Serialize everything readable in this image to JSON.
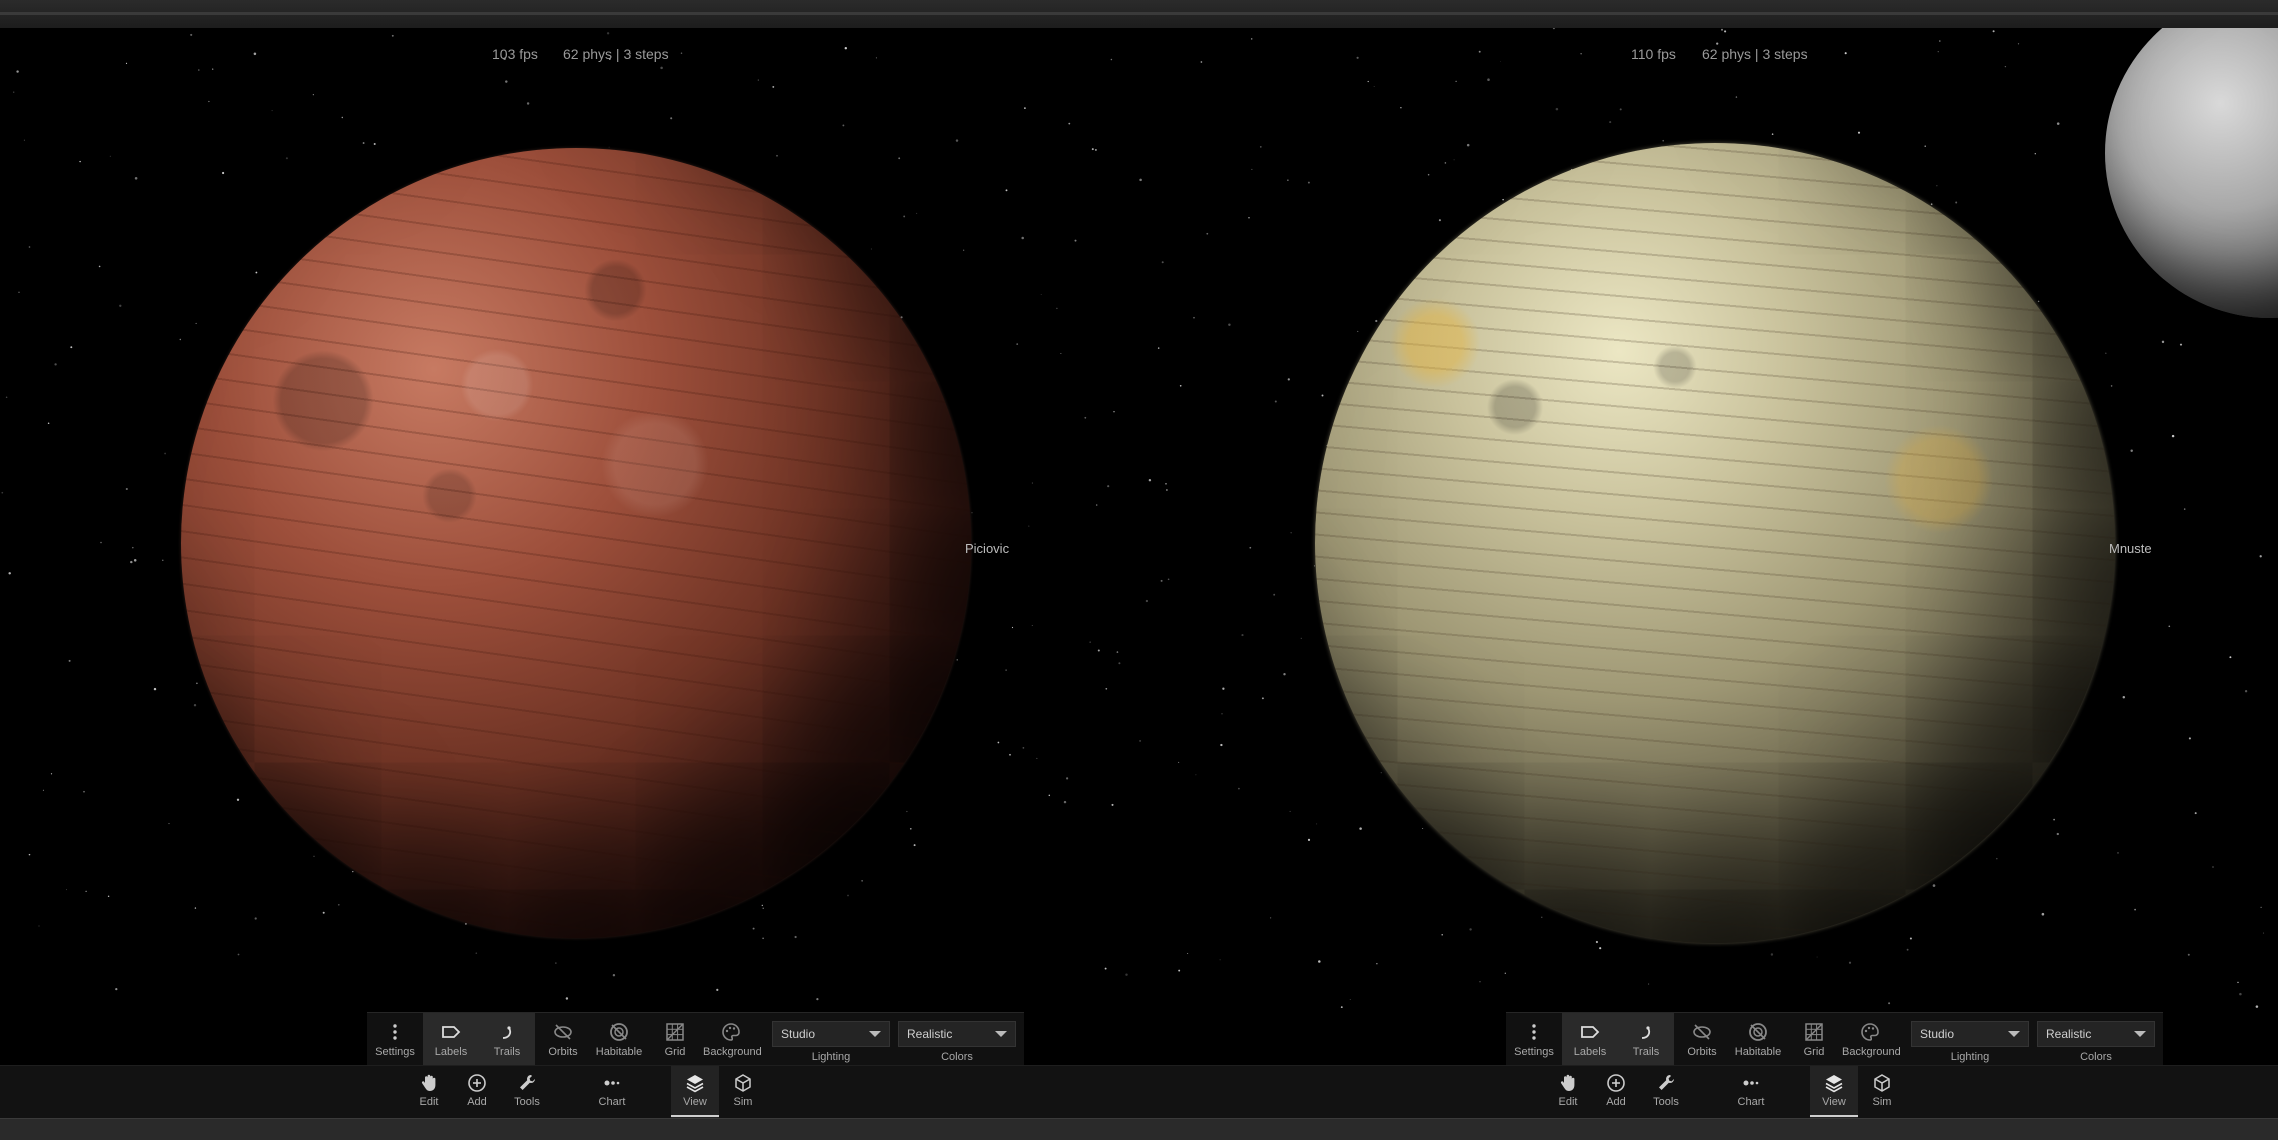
{
  "panes": [
    {
      "stats": {
        "fps": "103 fps",
        "phys": "62 phys | 3 steps"
      },
      "planet_label": "Piciovic",
      "view_tools": [
        {
          "label": "Settings",
          "icon": "kebab-menu-icon"
        },
        {
          "label": "Labels",
          "icon": "label-tag-icon",
          "active": true
        },
        {
          "label": "Trails",
          "icon": "trail-curve-icon",
          "active": true
        },
        {
          "label": "Orbits",
          "icon": "orbits-off-icon"
        },
        {
          "label": "Habitable",
          "icon": "habitable-off-icon"
        },
        {
          "label": "Grid",
          "icon": "grid-icon"
        },
        {
          "label": "Background",
          "icon": "palette-icon"
        }
      ],
      "lighting": {
        "value": "Studio",
        "caption": "Lighting"
      },
      "colors": {
        "value": "Realistic",
        "caption": "Colors"
      },
      "main_tools": [
        {
          "label": "Edit",
          "icon": "hand-icon"
        },
        {
          "label": "Add",
          "icon": "plus-circle-icon"
        },
        {
          "label": "Tools",
          "icon": "wrench-icon"
        },
        {
          "label": "Chart",
          "icon": "chart-dots-icon"
        },
        {
          "label": "View",
          "icon": "layers-icon",
          "active": true
        },
        {
          "label": "Sim",
          "icon": "cube-icon"
        }
      ]
    },
    {
      "stats": {
        "fps": "110 fps",
        "phys": "62 phys | 3 steps"
      },
      "planet_label": "Mnuste",
      "view_tools": [
        {
          "label": "Settings",
          "icon": "kebab-menu-icon"
        },
        {
          "label": "Labels",
          "icon": "label-tag-icon",
          "active": true
        },
        {
          "label": "Trails",
          "icon": "trail-curve-icon",
          "active": true
        },
        {
          "label": "Orbits",
          "icon": "orbits-off-icon"
        },
        {
          "label": "Habitable",
          "icon": "habitable-off-icon"
        },
        {
          "label": "Grid",
          "icon": "grid-icon"
        },
        {
          "label": "Background",
          "icon": "palette-icon"
        }
      ],
      "lighting": {
        "value": "Studio",
        "caption": "Lighting"
      },
      "colors": {
        "value": "Realistic",
        "caption": "Colors"
      },
      "main_tools": [
        {
          "label": "Edit",
          "icon": "hand-icon"
        },
        {
          "label": "Add",
          "icon": "plus-circle-icon"
        },
        {
          "label": "Tools",
          "icon": "wrench-icon"
        },
        {
          "label": "Chart",
          "icon": "chart-dots-icon"
        },
        {
          "label": "View",
          "icon": "layers-icon",
          "active": true
        },
        {
          "label": "Sim",
          "icon": "cube-icon"
        }
      ]
    }
  ],
  "colors": {
    "space": "#000000",
    "toolbar_bg": "#121212",
    "text": "#a8a8a8",
    "red_planet": "#9d4f3b",
    "yellow_planet": "#c9c29c"
  }
}
